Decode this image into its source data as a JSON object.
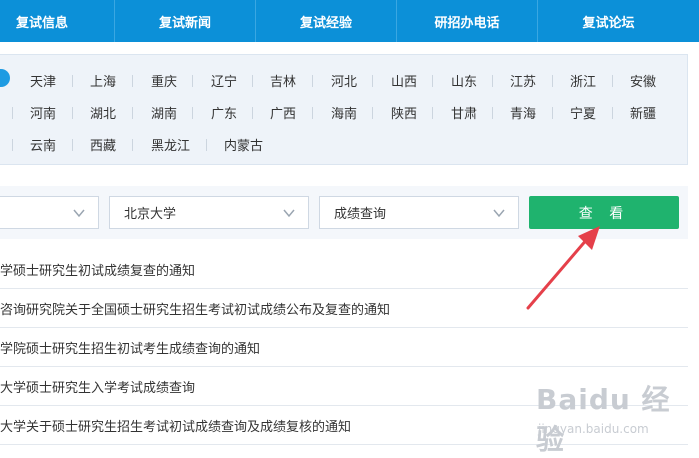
{
  "nav": {
    "items": [
      "复试信息",
      "复试新闻",
      "复试经验",
      "研招办电话",
      "复试论坛"
    ]
  },
  "provinces": {
    "row1": [
      "天津",
      "上海",
      "重庆",
      "辽宁",
      "吉林",
      "河北",
      "山西",
      "山东",
      "江苏",
      "浙江",
      "安徽"
    ],
    "row2": [
      "河南",
      "湖北",
      "湖南",
      "广东",
      "广西",
      "海南",
      "陕西",
      "甘肃",
      "青海",
      "宁夏",
      "新疆"
    ],
    "row3": [
      "云南",
      "西藏",
      "黑龙江",
      "内蒙古"
    ]
  },
  "filters": {
    "first_select": "",
    "school_select": "北京大学",
    "type_select": "成绩查询",
    "query_button": "查 看"
  },
  "notices": [
    "学硕士研究生初试成绩复查的通知",
    "咨询研究院关于全国硕士研究生招生考试初试成绩公布及复查的通知",
    "学院硕士研究生招生初试考生成绩查询的通知",
    "大学硕士研究生入学考试成绩查询",
    "大学关于硕士研究生招生考试初试成绩查询及成绩复核的通知"
  ],
  "watermark": {
    "brand": "Baidu 经验",
    "url": "jingyan.baidu.com"
  },
  "colors": {
    "nav_bg": "#0c90d8",
    "accent_green": "#1fb36e",
    "arrow_red": "#e5404a"
  }
}
